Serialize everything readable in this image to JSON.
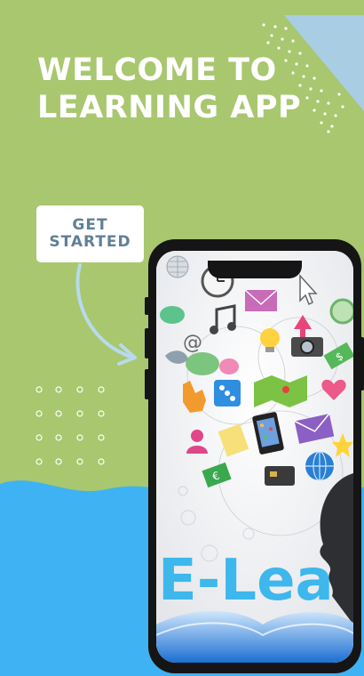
{
  "welcome": {
    "title": "WELCOME TO\nLEARNING APP"
  },
  "cta": {
    "label": "GET\nSTARTED"
  },
  "phone_screen": {
    "banner_text": "E-Lea"
  },
  "colors": {
    "background": "#a8c76f",
    "wave": "#3fb2f3",
    "title": "#ffffff",
    "button_text": "#5f8096",
    "accent_triangle": "#a9cde3"
  }
}
